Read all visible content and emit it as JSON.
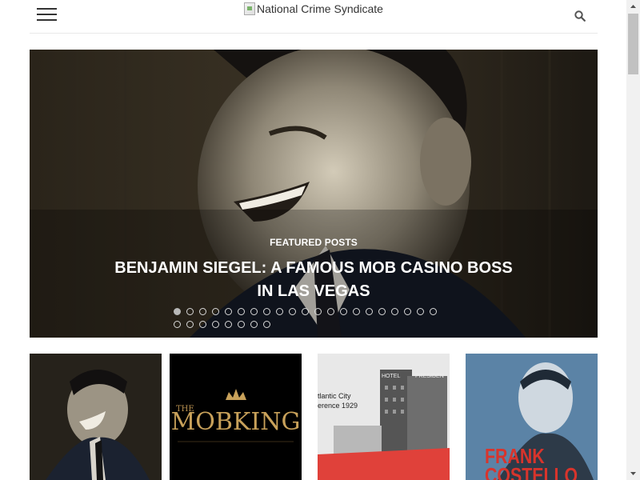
{
  "header": {
    "logo_alt": "National Crime Syndicate",
    "menu_icon": "hamburger-menu-icon",
    "search_icon": "search-icon"
  },
  "hero": {
    "category": "FEATURED POSTS",
    "title": "BENJAMIN SIEGEL: A FAMOUS MOB CASINO BOSS IN LAS VEGAS",
    "slide_count": 29,
    "active_slide": 1
  },
  "thumbnails": {
    "t2_the": "THE",
    "t2_title": "MOBKING",
    "t3_line1": "tlantic City",
    "t3_line2": "erence 1929",
    "t3_sign1": "HOTEL",
    "t3_sign2": "PRESIDEN",
    "t4_title": "FRANK",
    "t4_subtitle": "COSTELLO"
  },
  "colors": {
    "accent_gold": "#c8a15a",
    "frank_red": "#d8342c",
    "dot_border": "#d8d8d8"
  }
}
